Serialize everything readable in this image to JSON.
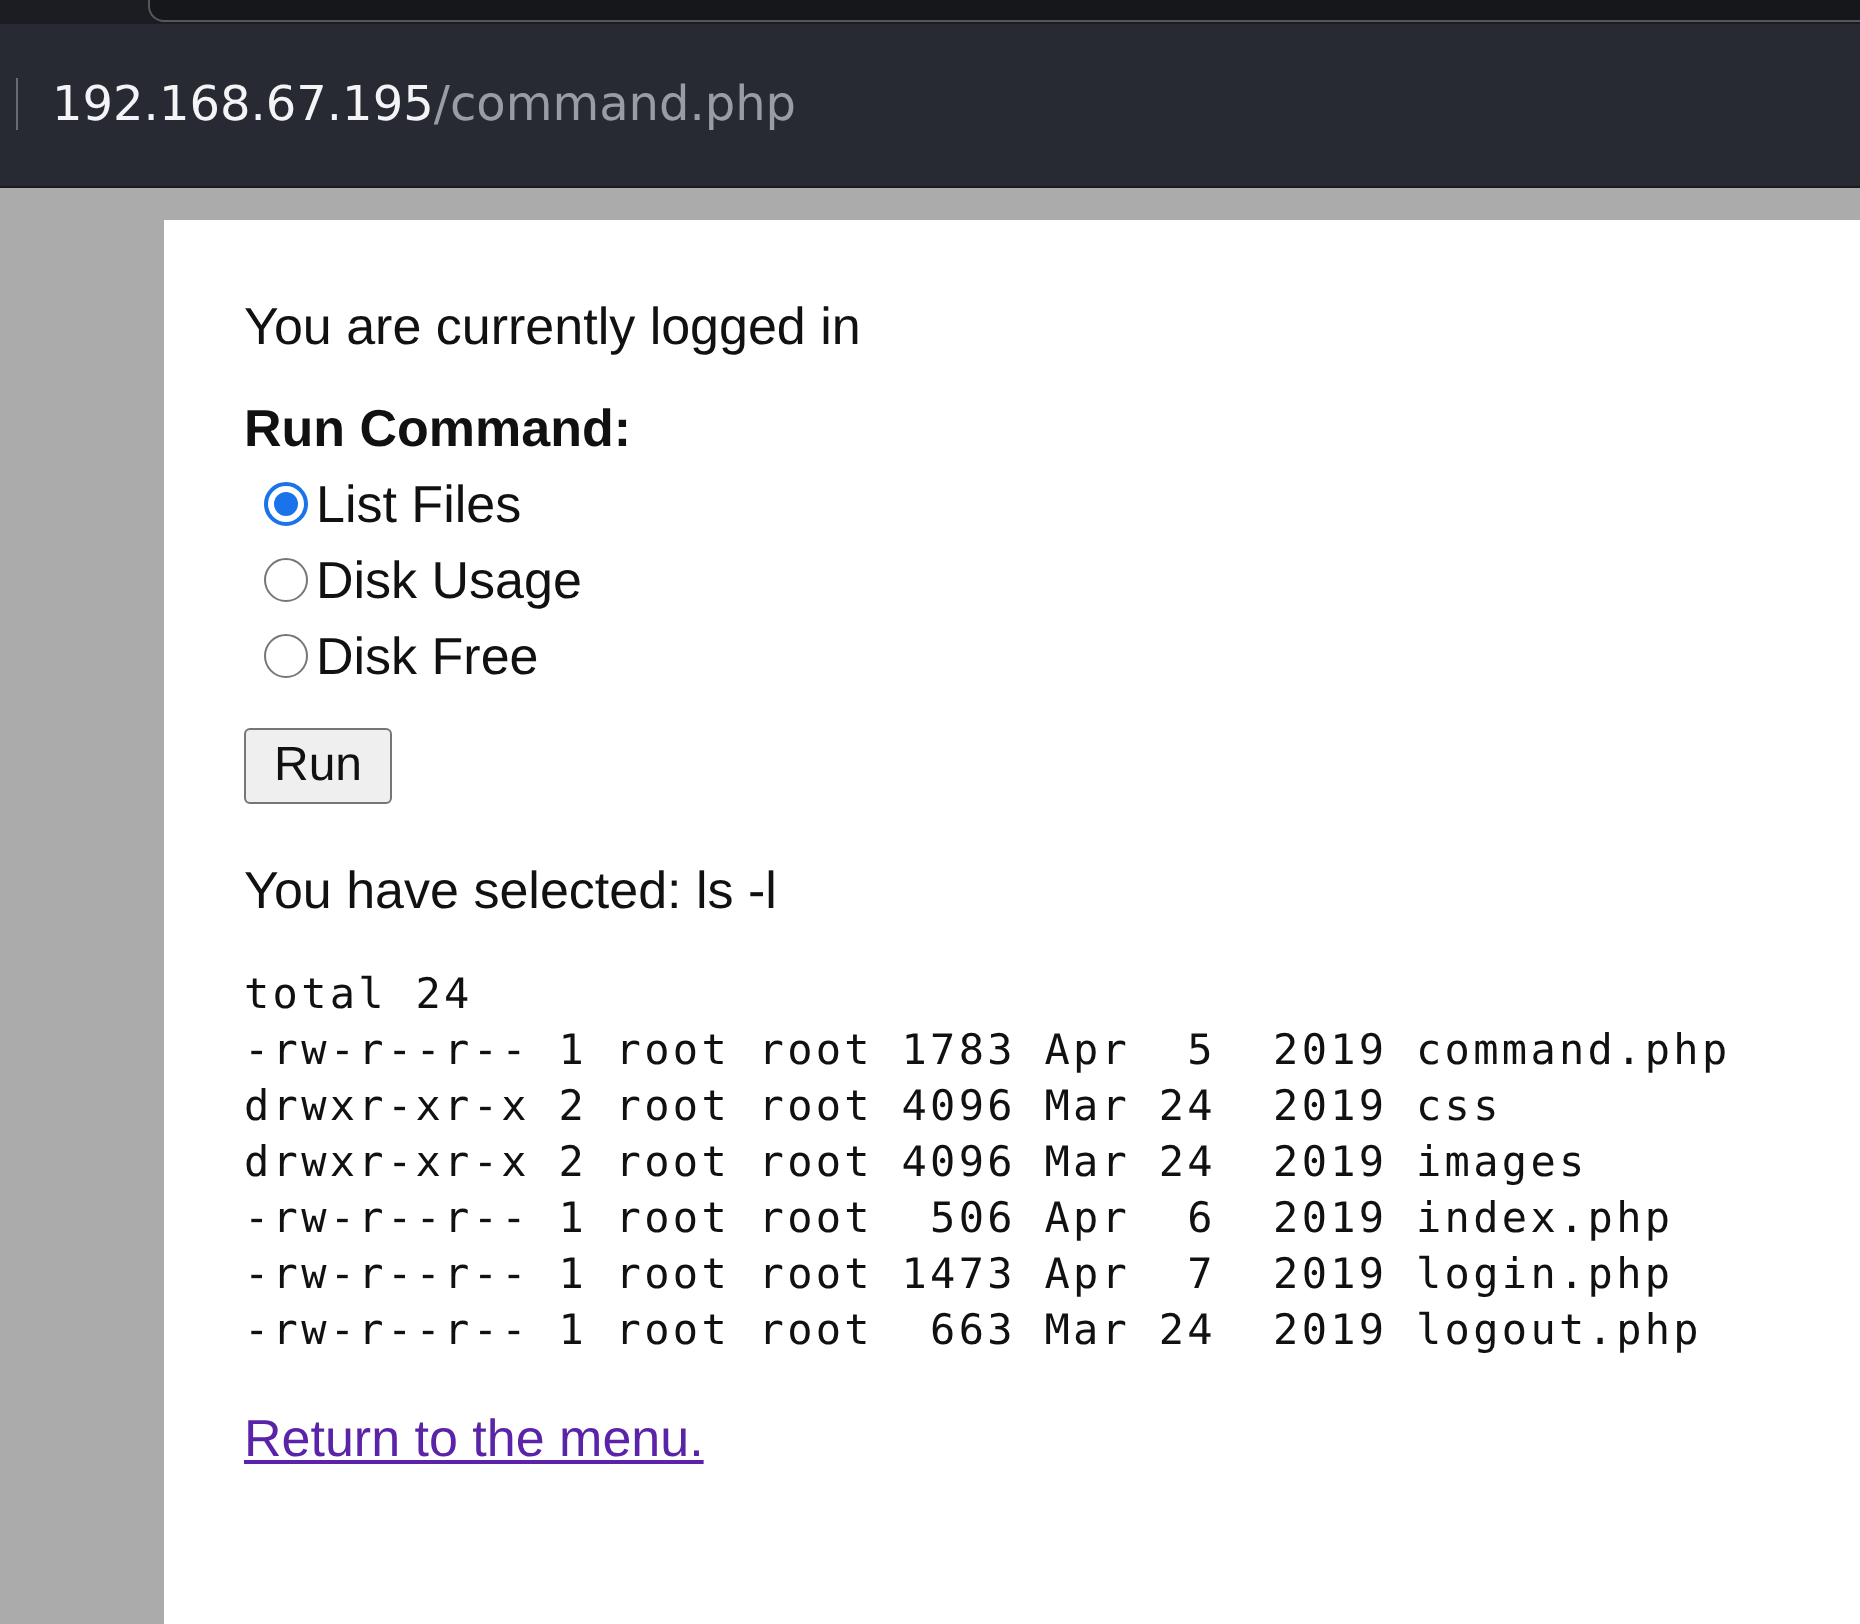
{
  "address_bar": {
    "host": "192.168.67.195",
    "path": "/command.php"
  },
  "page": {
    "status": "You are currently logged in",
    "form_label": "Run Command:",
    "options": [
      {
        "label": "List Files",
        "selected": true
      },
      {
        "label": "Disk Usage",
        "selected": false
      },
      {
        "label": "Disk Free",
        "selected": false
      }
    ],
    "button": "Run",
    "selection": "You have selected: ls -l",
    "output": [
      "total 24",
      "-rw-r--r-- 1 root root 1783 Apr  5  2019 command.php",
      "drwxr-xr-x 2 root root 4096 Mar 24  2019 css",
      "drwxr-xr-x 2 root root 4096 Mar 24  2019 images",
      "-rw-r--r-- 1 root root  506 Apr  6  2019 index.php",
      "-rw-r--r-- 1 root root 1473 Apr  7  2019 login.php",
      "-rw-r--r-- 1 root root  663 Mar 24  2019 logout.php"
    ],
    "link": "Return to the menu."
  }
}
